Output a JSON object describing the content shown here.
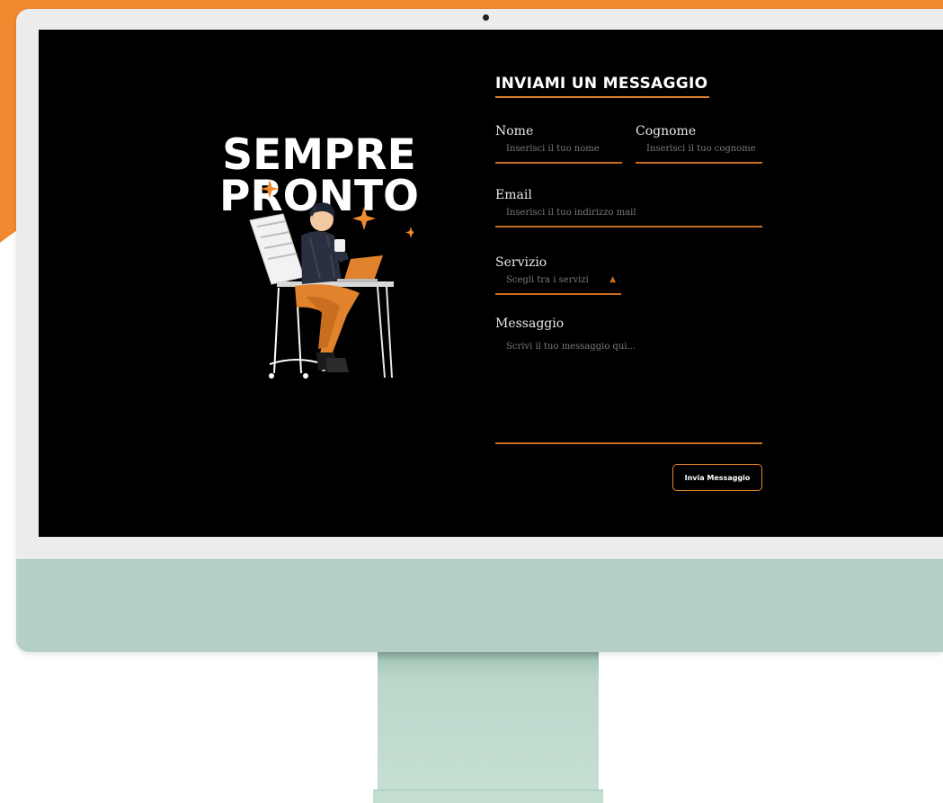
{
  "colors": {
    "accent": "#e0832c",
    "screen": "#000000",
    "monitor_body": "#b5d0c4",
    "bezel": "#ececec",
    "background_shape": "#f08a30"
  },
  "hero": {
    "title_line1": "SEMPRE",
    "title_line2": "PRONTO"
  },
  "form": {
    "title": "INVIAMI UN MESSAGGIO",
    "first_name": {
      "label": "Nome",
      "placeholder": "Inserisci il tuo nome"
    },
    "last_name": {
      "label": "Cognome",
      "placeholder": "Inserisci il tuo cognome"
    },
    "email": {
      "label": "Email",
      "placeholder": "Inserisci il tuo indirizzo mail"
    },
    "service": {
      "label": "Servizio",
      "value": "Scegli tra i servizi",
      "icon": "chevron-updown-icon"
    },
    "message": {
      "label": "Messaggio",
      "placeholder": "Scrivi il tuo messaggio qui..."
    },
    "submit_label": "Invia Messaggio"
  }
}
